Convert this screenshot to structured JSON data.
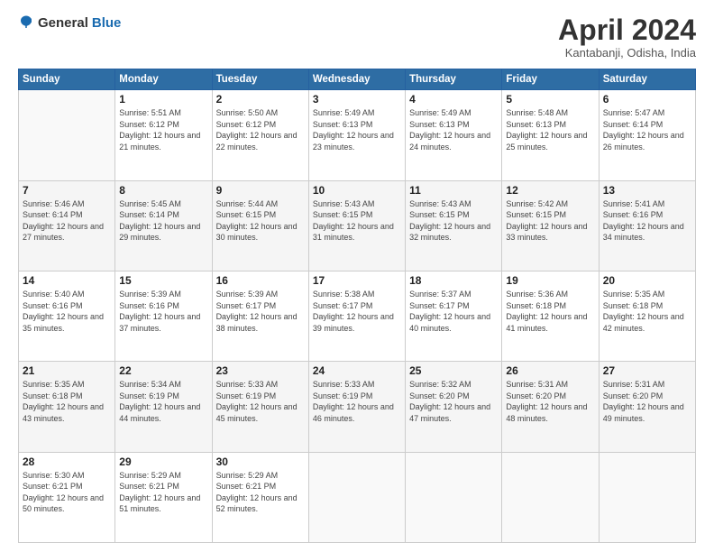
{
  "header": {
    "logo_general": "General",
    "logo_blue": "Blue",
    "month": "April 2024",
    "location": "Kantabanji, Odisha, India"
  },
  "days_of_week": [
    "Sunday",
    "Monday",
    "Tuesday",
    "Wednesday",
    "Thursday",
    "Friday",
    "Saturday"
  ],
  "weeks": [
    [
      {
        "day": "",
        "sunrise": "",
        "sunset": "",
        "daylight": ""
      },
      {
        "day": "1",
        "sunrise": "Sunrise: 5:51 AM",
        "sunset": "Sunset: 6:12 PM",
        "daylight": "Daylight: 12 hours and 21 minutes."
      },
      {
        "day": "2",
        "sunrise": "Sunrise: 5:50 AM",
        "sunset": "Sunset: 6:12 PM",
        "daylight": "Daylight: 12 hours and 22 minutes."
      },
      {
        "day": "3",
        "sunrise": "Sunrise: 5:49 AM",
        "sunset": "Sunset: 6:13 PM",
        "daylight": "Daylight: 12 hours and 23 minutes."
      },
      {
        "day": "4",
        "sunrise": "Sunrise: 5:49 AM",
        "sunset": "Sunset: 6:13 PM",
        "daylight": "Daylight: 12 hours and 24 minutes."
      },
      {
        "day": "5",
        "sunrise": "Sunrise: 5:48 AM",
        "sunset": "Sunset: 6:13 PM",
        "daylight": "Daylight: 12 hours and 25 minutes."
      },
      {
        "day": "6",
        "sunrise": "Sunrise: 5:47 AM",
        "sunset": "Sunset: 6:14 PM",
        "daylight": "Daylight: 12 hours and 26 minutes."
      }
    ],
    [
      {
        "day": "7",
        "sunrise": "Sunrise: 5:46 AM",
        "sunset": "Sunset: 6:14 PM",
        "daylight": "Daylight: 12 hours and 27 minutes."
      },
      {
        "day": "8",
        "sunrise": "Sunrise: 5:45 AM",
        "sunset": "Sunset: 6:14 PM",
        "daylight": "Daylight: 12 hours and 29 minutes."
      },
      {
        "day": "9",
        "sunrise": "Sunrise: 5:44 AM",
        "sunset": "Sunset: 6:15 PM",
        "daylight": "Daylight: 12 hours and 30 minutes."
      },
      {
        "day": "10",
        "sunrise": "Sunrise: 5:43 AM",
        "sunset": "Sunset: 6:15 PM",
        "daylight": "Daylight: 12 hours and 31 minutes."
      },
      {
        "day": "11",
        "sunrise": "Sunrise: 5:43 AM",
        "sunset": "Sunset: 6:15 PM",
        "daylight": "Daylight: 12 hours and 32 minutes."
      },
      {
        "day": "12",
        "sunrise": "Sunrise: 5:42 AM",
        "sunset": "Sunset: 6:15 PM",
        "daylight": "Daylight: 12 hours and 33 minutes."
      },
      {
        "day": "13",
        "sunrise": "Sunrise: 5:41 AM",
        "sunset": "Sunset: 6:16 PM",
        "daylight": "Daylight: 12 hours and 34 minutes."
      }
    ],
    [
      {
        "day": "14",
        "sunrise": "Sunrise: 5:40 AM",
        "sunset": "Sunset: 6:16 PM",
        "daylight": "Daylight: 12 hours and 35 minutes."
      },
      {
        "day": "15",
        "sunrise": "Sunrise: 5:39 AM",
        "sunset": "Sunset: 6:16 PM",
        "daylight": "Daylight: 12 hours and 37 minutes."
      },
      {
        "day": "16",
        "sunrise": "Sunrise: 5:39 AM",
        "sunset": "Sunset: 6:17 PM",
        "daylight": "Daylight: 12 hours and 38 minutes."
      },
      {
        "day": "17",
        "sunrise": "Sunrise: 5:38 AM",
        "sunset": "Sunset: 6:17 PM",
        "daylight": "Daylight: 12 hours and 39 minutes."
      },
      {
        "day": "18",
        "sunrise": "Sunrise: 5:37 AM",
        "sunset": "Sunset: 6:17 PM",
        "daylight": "Daylight: 12 hours and 40 minutes."
      },
      {
        "day": "19",
        "sunrise": "Sunrise: 5:36 AM",
        "sunset": "Sunset: 6:18 PM",
        "daylight": "Daylight: 12 hours and 41 minutes."
      },
      {
        "day": "20",
        "sunrise": "Sunrise: 5:35 AM",
        "sunset": "Sunset: 6:18 PM",
        "daylight": "Daylight: 12 hours and 42 minutes."
      }
    ],
    [
      {
        "day": "21",
        "sunrise": "Sunrise: 5:35 AM",
        "sunset": "Sunset: 6:18 PM",
        "daylight": "Daylight: 12 hours and 43 minutes."
      },
      {
        "day": "22",
        "sunrise": "Sunrise: 5:34 AM",
        "sunset": "Sunset: 6:19 PM",
        "daylight": "Daylight: 12 hours and 44 minutes."
      },
      {
        "day": "23",
        "sunrise": "Sunrise: 5:33 AM",
        "sunset": "Sunset: 6:19 PM",
        "daylight": "Daylight: 12 hours and 45 minutes."
      },
      {
        "day": "24",
        "sunrise": "Sunrise: 5:33 AM",
        "sunset": "Sunset: 6:19 PM",
        "daylight": "Daylight: 12 hours and 46 minutes."
      },
      {
        "day": "25",
        "sunrise": "Sunrise: 5:32 AM",
        "sunset": "Sunset: 6:20 PM",
        "daylight": "Daylight: 12 hours and 47 minutes."
      },
      {
        "day": "26",
        "sunrise": "Sunrise: 5:31 AM",
        "sunset": "Sunset: 6:20 PM",
        "daylight": "Daylight: 12 hours and 48 minutes."
      },
      {
        "day": "27",
        "sunrise": "Sunrise: 5:31 AM",
        "sunset": "Sunset: 6:20 PM",
        "daylight": "Daylight: 12 hours and 49 minutes."
      }
    ],
    [
      {
        "day": "28",
        "sunrise": "Sunrise: 5:30 AM",
        "sunset": "Sunset: 6:21 PM",
        "daylight": "Daylight: 12 hours and 50 minutes."
      },
      {
        "day": "29",
        "sunrise": "Sunrise: 5:29 AM",
        "sunset": "Sunset: 6:21 PM",
        "daylight": "Daylight: 12 hours and 51 minutes."
      },
      {
        "day": "30",
        "sunrise": "Sunrise: 5:29 AM",
        "sunset": "Sunset: 6:21 PM",
        "daylight": "Daylight: 12 hours and 52 minutes."
      },
      {
        "day": "",
        "sunrise": "",
        "sunset": "",
        "daylight": ""
      },
      {
        "day": "",
        "sunrise": "",
        "sunset": "",
        "daylight": ""
      },
      {
        "day": "",
        "sunrise": "",
        "sunset": "",
        "daylight": ""
      },
      {
        "day": "",
        "sunrise": "",
        "sunset": "",
        "daylight": ""
      }
    ]
  ]
}
